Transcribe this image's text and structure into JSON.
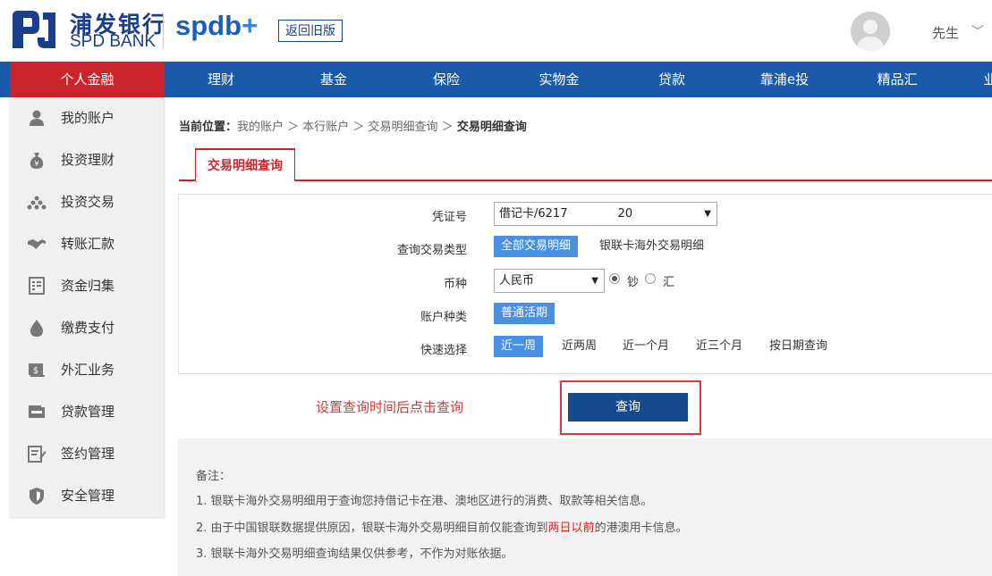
{
  "header": {
    "logo_cn": "浦发银行",
    "logo_en": "SPD BANK",
    "brand": "spdb",
    "brand_plus": "+",
    "old_version_button": "返回旧版",
    "user_name": "先生",
    "user_caret": "﹀"
  },
  "nav": {
    "items": [
      "个人金融",
      "理财",
      "基金",
      "保险",
      "实物金",
      "贷款",
      "靠浦e投",
      "精品汇",
      "业"
    ]
  },
  "sidebar": {
    "items": [
      {
        "label": "我的账户",
        "icon": "user-icon"
      },
      {
        "label": "投资理财",
        "icon": "money-bag-icon"
      },
      {
        "label": "投资交易",
        "icon": "pyramid-icon"
      },
      {
        "label": "转账汇款",
        "icon": "handshake-icon"
      },
      {
        "label": "资金归集",
        "icon": "ledger-icon"
      },
      {
        "label": "缴费支付",
        "icon": "drop-icon"
      },
      {
        "label": "外汇业务",
        "icon": "currency-icon"
      },
      {
        "label": "贷款管理",
        "icon": "wallet-icon"
      },
      {
        "label": "签约管理",
        "icon": "contract-icon"
      },
      {
        "label": "安全管理",
        "icon": "shield-icon"
      }
    ]
  },
  "breadcrumb": {
    "prefix": "当前位置：",
    "path": "我的账户 ＞ 本行账户 ＞ 交易明细查询 ＞",
    "current": "交易明细查询"
  },
  "tab": {
    "label": "交易明细查询"
  },
  "form": {
    "voucher_label": "凭证号",
    "voucher_value": "借记卡/6217　　　　 20",
    "type_label": "查询交易类型",
    "type_options": [
      "全部交易明细",
      "银联卡海外交易明细"
    ],
    "currency_label": "币种",
    "currency_value": "人民币",
    "cash_label": "钞",
    "remit_label": "汇",
    "account_type_label": "账户种类",
    "account_type_value": "普通活期",
    "quick_label": "快速选择",
    "quick_options": [
      "近一周",
      "近两周",
      "近一个月",
      "近三个月",
      "按日期查询"
    ]
  },
  "hint": "设置查询时间后点击查询",
  "query_button": "查询",
  "notes": {
    "title": "备注：",
    "line1": "1. 银联卡海外交易明细用于查询您持借记卡在港、澳地区进行的消费、取款等相关信息。",
    "line2_pre": "2. 由于中国银联数据提供原因，银联卡海外交易明细目前仅能查询到",
    "line2_red": "两日以前",
    "line2_post": "的港澳用卡信息。",
    "line3": "3. 银联卡海外交易明细查询结果仅供参考，不作为对账依据。"
  },
  "colors": {
    "brand_blue": "#1a5aa8",
    "brand_red": "#c9242c",
    "button_blue": "#174b8d",
    "chip_blue": "#4a90e2"
  }
}
